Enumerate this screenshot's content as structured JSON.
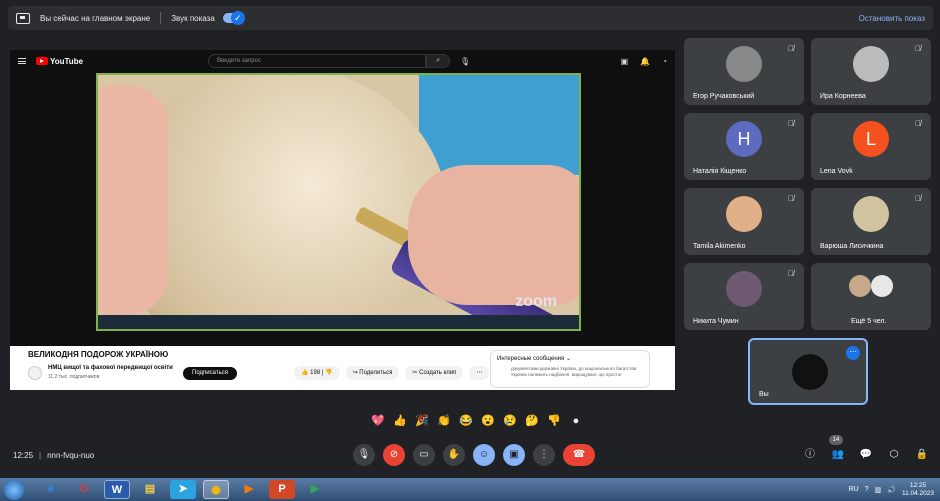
{
  "topbar": {
    "presenting_text": "Вы сейчас на главном экране",
    "sound_label": "Звук показа",
    "stop_label": "Остановить показ"
  },
  "youtube": {
    "logo": "YouTube",
    "search_placeholder": "Введите запрос",
    "video_watermark": "zoom",
    "title": "ВЕЛИКОДНЯ ПОДОРОЖ УКРАЇНОЮ",
    "channel": "НМЦ вищої та фахової передвищої освіти",
    "subscribers": "11,2 тыс. подписчиков",
    "subscribe_label": "Подписаться",
    "likes": "198",
    "share_label": "Поделиться",
    "clip_label": "Создать клип",
    "panel_title": "Интересные сообщения",
    "panel_text": "документами державні Україна, до національного багатства України належать надбання, вирощувані, що простої"
  },
  "participants": [
    {
      "name": "Егор Ручаковський",
      "initial": "",
      "color": "#888888"
    },
    {
      "name": "Ира Корнеева",
      "initial": "",
      "color": "#bbbbbb"
    },
    {
      "name": "Наталія Кіщенко",
      "initial": "H",
      "color": "#5c6bc0"
    },
    {
      "name": "Lena Vovk",
      "initial": "L",
      "color": "#f4511e"
    },
    {
      "name": "Tamila Akimenko",
      "initial": "",
      "color": "#e0b089"
    },
    {
      "name": "Варюша Лисичкина",
      "initial": "",
      "color": "#d2c4a0"
    },
    {
      "name": "Никита Чумин",
      "initial": "",
      "color": "#6d5a72"
    },
    {
      "name": "Ещё 5 чел.",
      "initial": "",
      "color": ""
    }
  ],
  "self_tile": {
    "name": "Вы"
  },
  "meeting": {
    "time": "12:25",
    "code": "nnn-fvqu-nuo",
    "people_count": "14"
  },
  "taskbar": {
    "lang": "RU",
    "time": "12:25",
    "date": "11.04.2023"
  }
}
